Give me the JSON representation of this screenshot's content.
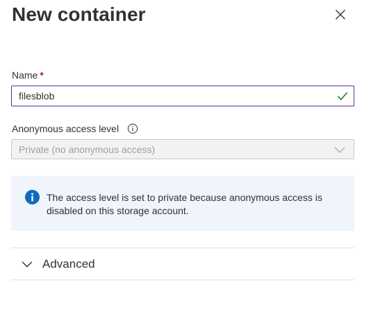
{
  "panel": {
    "title": "New container"
  },
  "name_field": {
    "label": "Name",
    "required_marker": "*",
    "value": "filesblob"
  },
  "access_field": {
    "label": "Anonymous access level",
    "selected_value": "Private (no anonymous access)"
  },
  "info_message": {
    "text": "The access level is set to private because anonymous access is disabled on this storage account."
  },
  "advanced_section": {
    "label": "Advanced"
  },
  "icons": {
    "close": "close-icon",
    "valid": "checkmark-icon",
    "field_info": "info-icon",
    "dropdown": "chevron-down-icon",
    "message": "info-filled-icon",
    "expand": "chevron-down-icon"
  },
  "colors": {
    "input_border_focus": "#5c2e91",
    "valid_check": "#107c10",
    "required": "#a4262c",
    "info_icon": "#0f6cbd",
    "info_box_bg": "#f0f4fb",
    "disabled_bg": "#f3f2f1"
  }
}
